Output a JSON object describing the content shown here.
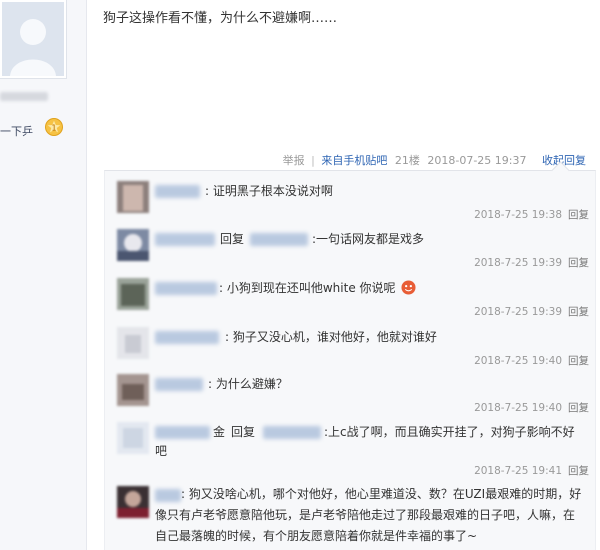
{
  "left": {
    "level_text": "一下乒",
    "badge_number": "1"
  },
  "post": {
    "text": "狗子这操作看不懂，为什么不避嫌啊……",
    "report": "举报",
    "separator": "|",
    "source": "来自手机贴吧",
    "floor": "21楼",
    "time": "2018-07-25 19:37",
    "collapse": "收起回复"
  },
  "replies": [
    {
      "text": ": 证明黑子根本没说对啊",
      "time": "2018-7-25 19:38",
      "reply": "回复"
    },
    {
      "reply_word": "回复",
      "text": ":一句话网友都是戏多",
      "time": "2018-7-25 19:39",
      "reply": "回复"
    },
    {
      "text": ": 小狗到现在还叫他white 你说呢",
      "time": "2018-7-25 19:39",
      "reply": "回复"
    },
    {
      "text": ": 狗子又没心机，谁对他好，他就对谁好",
      "time": "2018-7-25 19:40",
      "reply": "回复"
    },
    {
      "text": ": 为什么避嫌？",
      "time": "2018-7-25 19:40",
      "reply": "回复"
    },
    {
      "name_suffix": "金",
      "reply_word": "回复",
      "text_line1": ":上c战了啊，而且确实开挂了，对狗子影响不好",
      "text_line2": "吧",
      "time": "2018-7-25 19:41",
      "reply": "回复"
    },
    {
      "text_line1": ": 狗又没啥心机，哪个对他好，他心里难道没、数？在UZI最艰难的时期，好",
      "text_line2": "像只有卢老爷愿意陪他玩，是卢老爷陪他走过了那段最艰难的日子吧，人嘛，在",
      "text_line3": "自己最落魄的时候，有个朋友愿意陪着你就是件幸福的事了~"
    }
  ],
  "colors": {
    "link_blue": "#2d64b3",
    "meta_gray": "#999999",
    "reply_bg": "#f7f8fa"
  }
}
